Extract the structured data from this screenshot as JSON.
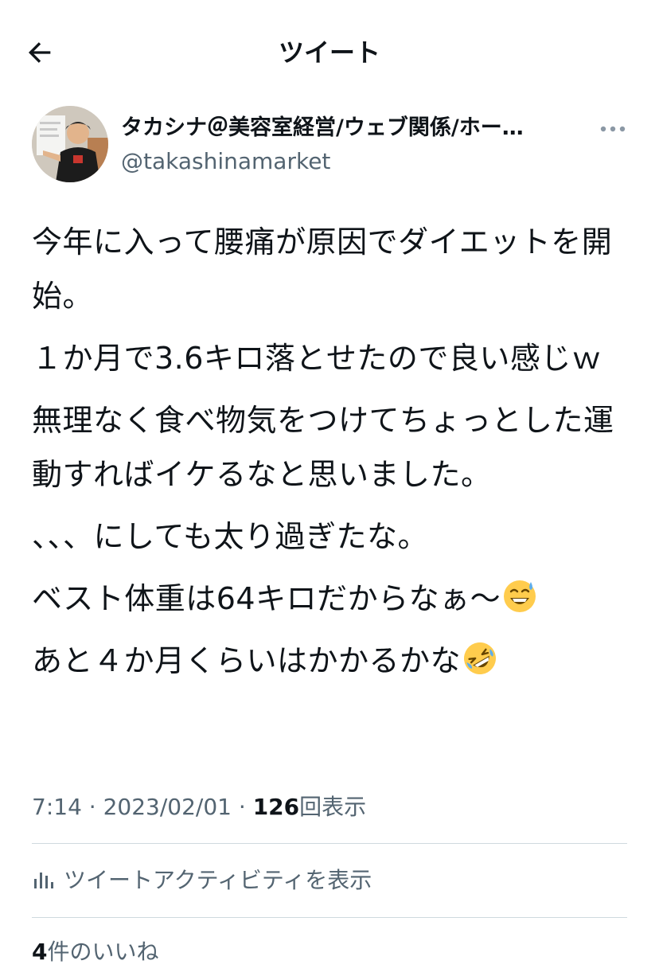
{
  "header": {
    "title": "ツイート",
    "back_icon": "arrow-left-icon"
  },
  "author": {
    "display_name": "タカシナ＠美容室経営/ウェブ関係/ホー…",
    "handle": "@takashinamarket",
    "more_icon": "ellipsis-icon"
  },
  "tweet": {
    "paragraphs": [
      "今年に入って腰痛が原因でダイエットを開始。",
      "１か月で3.6キロ落とせたので良い感じｗ",
      "無理なく食べ物気をつけてちょっとした運動すればイケるなと思いました。",
      "、、、にしても太り過ぎたな。",
      "ベスト体重は64キロだからなぁ〜",
      "あと４か月くらいはかかるかな"
    ],
    "emoji_sweat_smile": "grinning-face-with-sweat-icon",
    "emoji_rofl": "rolling-on-floor-laughing-icon"
  },
  "meta": {
    "time": "7:14",
    "separator": " · ",
    "date": "2023/02/01",
    "separator2": " · ",
    "views_count": "126",
    "views_label": "回表示"
  },
  "activity": {
    "label": "ツイートアクティビティを表示",
    "icon": "bar-chart-icon"
  },
  "likes": {
    "count": "4",
    "label": "件のいいね"
  },
  "colors": {
    "text_primary": "#0f1419",
    "text_secondary": "#536471",
    "divider": "#cfd9de"
  }
}
